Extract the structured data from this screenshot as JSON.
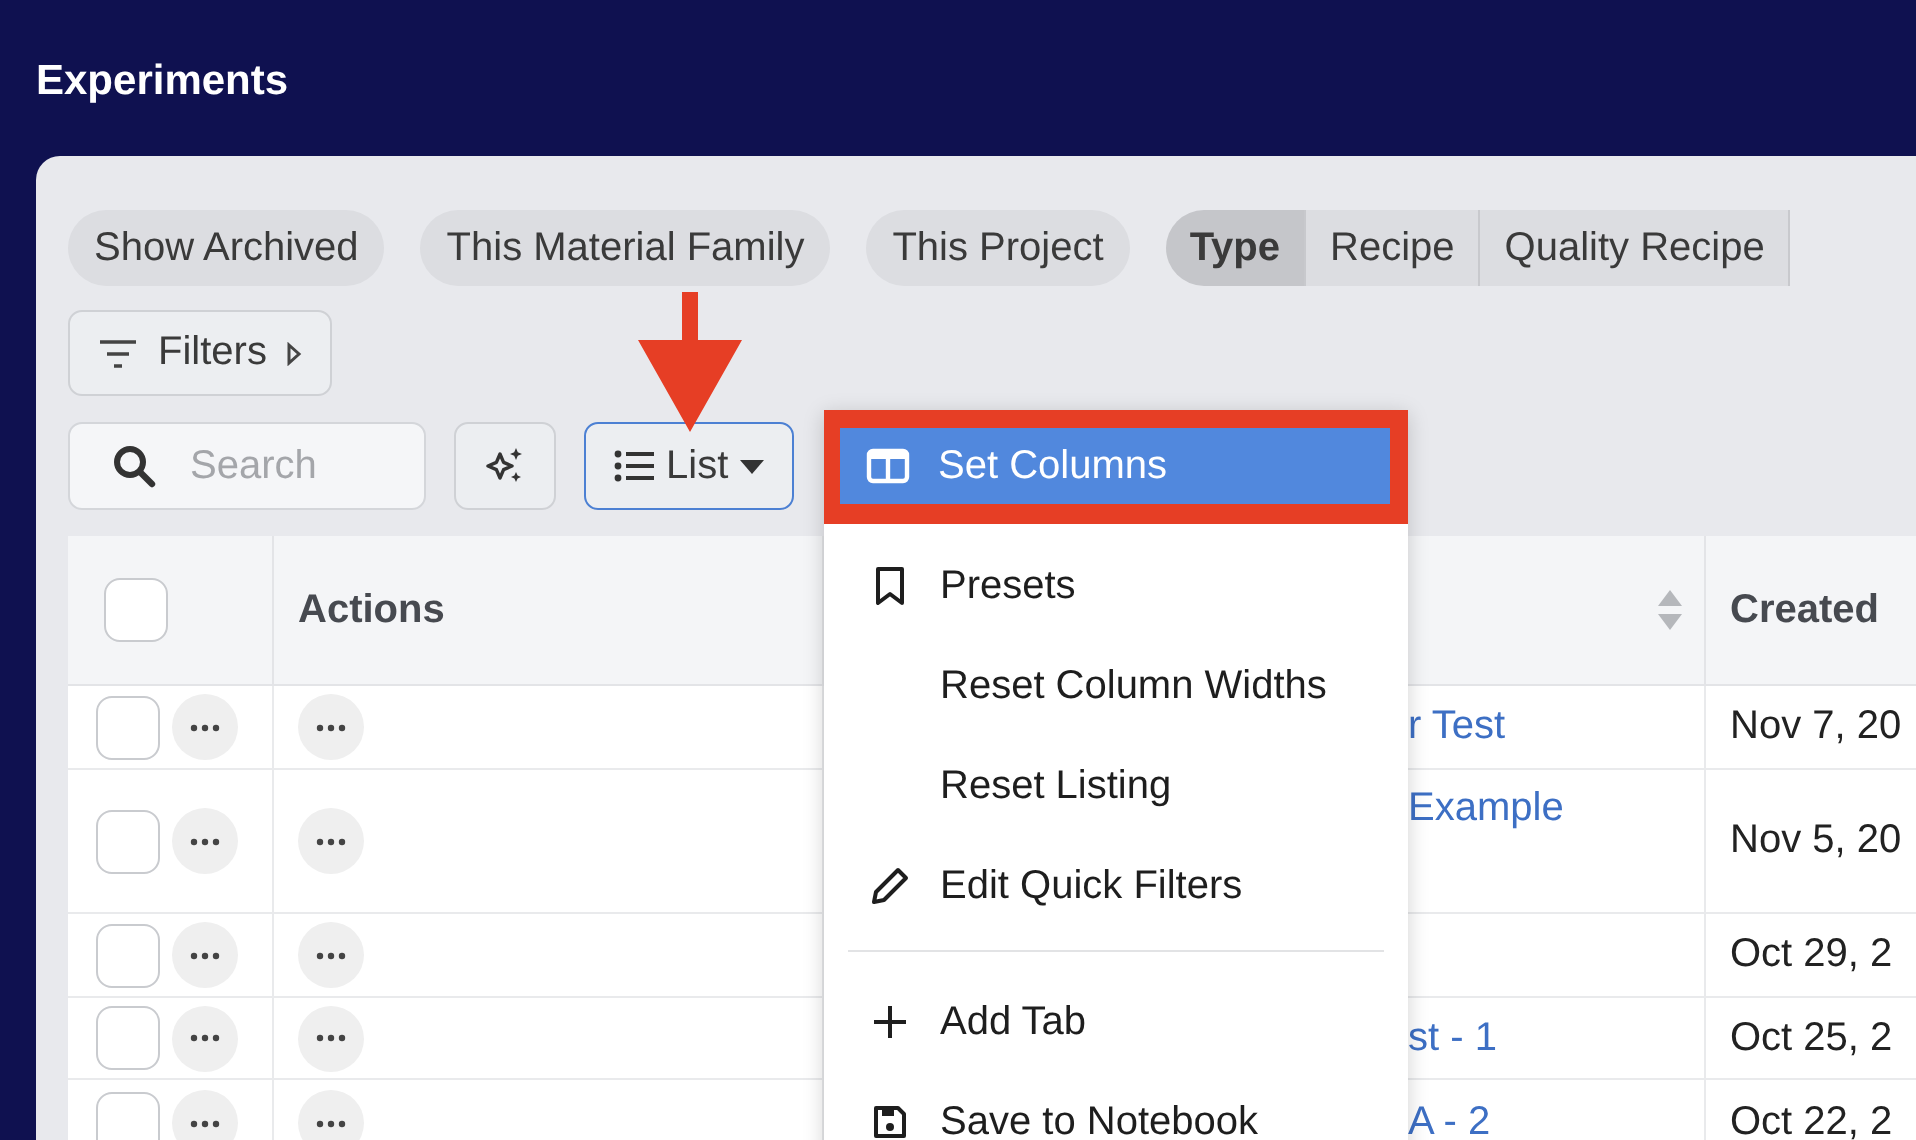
{
  "title": "Experiments",
  "quick_filters": [
    {
      "label": "Show Archived"
    },
    {
      "label": "This Material Family"
    },
    {
      "label": "This Project"
    }
  ],
  "group_by": [
    {
      "label": "Type",
      "selected": true
    },
    {
      "label": "Recipe",
      "selected": false
    },
    {
      "label": "Quality Recipe",
      "selected": false
    }
  ],
  "filters_button": {
    "label": "Filters"
  },
  "search": {
    "placeholder": "Search"
  },
  "view_button": {
    "label": "List"
  },
  "table": {
    "select_all": {
      "checked": false
    },
    "columns": [
      "Actions",
      "Created"
    ],
    "rows": [
      {
        "checked": false,
        "name": "r Test",
        "created": "Nov 7, 20"
      },
      {
        "checked": false,
        "name": "Example",
        "created": "Nov 5, 20"
      },
      {
        "checked": false,
        "created": "Oct 29, 2"
      },
      {
        "checked": false,
        "name": "st - 1",
        "created": "Oct 25, 2"
      },
      {
        "checked": false,
        "name": "A - 2",
        "created": "Oct 22, 2"
      }
    ]
  },
  "menu": {
    "sections": [
      {
        "items": [
          {
            "label": "Set Columns",
            "selected": true,
            "highlighted": true
          },
          {
            "label": "Presets",
            "selected": false,
            "highlighted": false
          },
          {
            "label": "Reset Column Widths",
            "selected": false,
            "highlighted": false
          },
          {
            "label": "Reset Listing",
            "selected": false,
            "highlighted": false
          },
          {
            "label": "Edit Quick Filters",
            "selected": false,
            "highlighted": false
          }
        ]
      },
      {
        "items": [
          {
            "label": "Add Tab",
            "selected": false,
            "highlighted": false
          },
          {
            "label": "Save to Notebook",
            "selected": false,
            "highlighted": false
          }
        ]
      }
    ]
  }
}
